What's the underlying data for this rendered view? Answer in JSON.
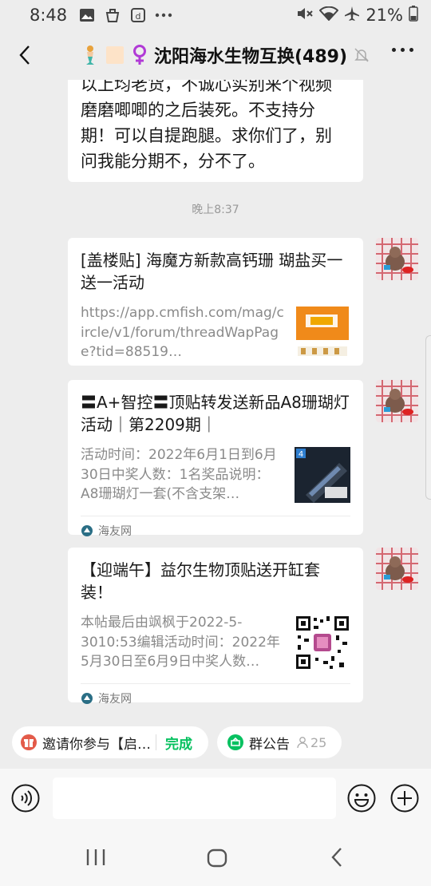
{
  "status_bar": {
    "time": "8:48",
    "battery": "21%",
    "icons": [
      "image-icon",
      "app-icon",
      "app-icon",
      "more-icon",
      "mute-icon",
      "wifi-icon",
      "airplane-icon",
      "battery-icon"
    ]
  },
  "header": {
    "title": "沈阳海水生物互换(489)",
    "icons": [
      "mermaid-icon",
      "blank-square-icon",
      "female-sign-icon",
      "mute-bell-icon"
    ]
  },
  "messages": {
    "text_bubble": {
      "lines": [
        "以上均老货，不诚心实别来个视频",
        "磨磨唧唧的之后装死。不支持分",
        "期！可以自提跑腿。求你们了，别",
        "问我能分期不，分不了。"
      ]
    },
    "timestamp": "晚上8:37",
    "cards": [
      {
        "title": "[盖楼贴] 海魔方新款高钙珊 瑚盐买一送一活动",
        "desc": "https://app.cmfish.com/mag/circle/v1/forum/threadWapPage?tid=88519…",
        "source": ""
      },
      {
        "title": "〓A+智控〓顶贴转发送新品A8珊瑚灯活动｜第2209期｜",
        "desc": "活动时间：2022年6月1日到6月30日中奖人数：1名奖品说明：A8珊瑚灯一套(不含支架…",
        "source": "海友网"
      },
      {
        "title": "【迎端午】益尔生物顶贴送开缸套装！",
        "desc": "本帖最后由飒枫于2022-5-3010:53编辑活动时间：2022年5月30日至6月9日中奖人数…",
        "source": "海友网"
      }
    ]
  },
  "quick_bar": {
    "invite_text": "邀请你参与【启…",
    "invite_status": "完成",
    "notice_label": "群公告",
    "notice_count": "25"
  },
  "input_bar": {
    "placeholder": ""
  },
  "colors": {
    "accent_green": "#07c160",
    "background": "#ededed"
  }
}
